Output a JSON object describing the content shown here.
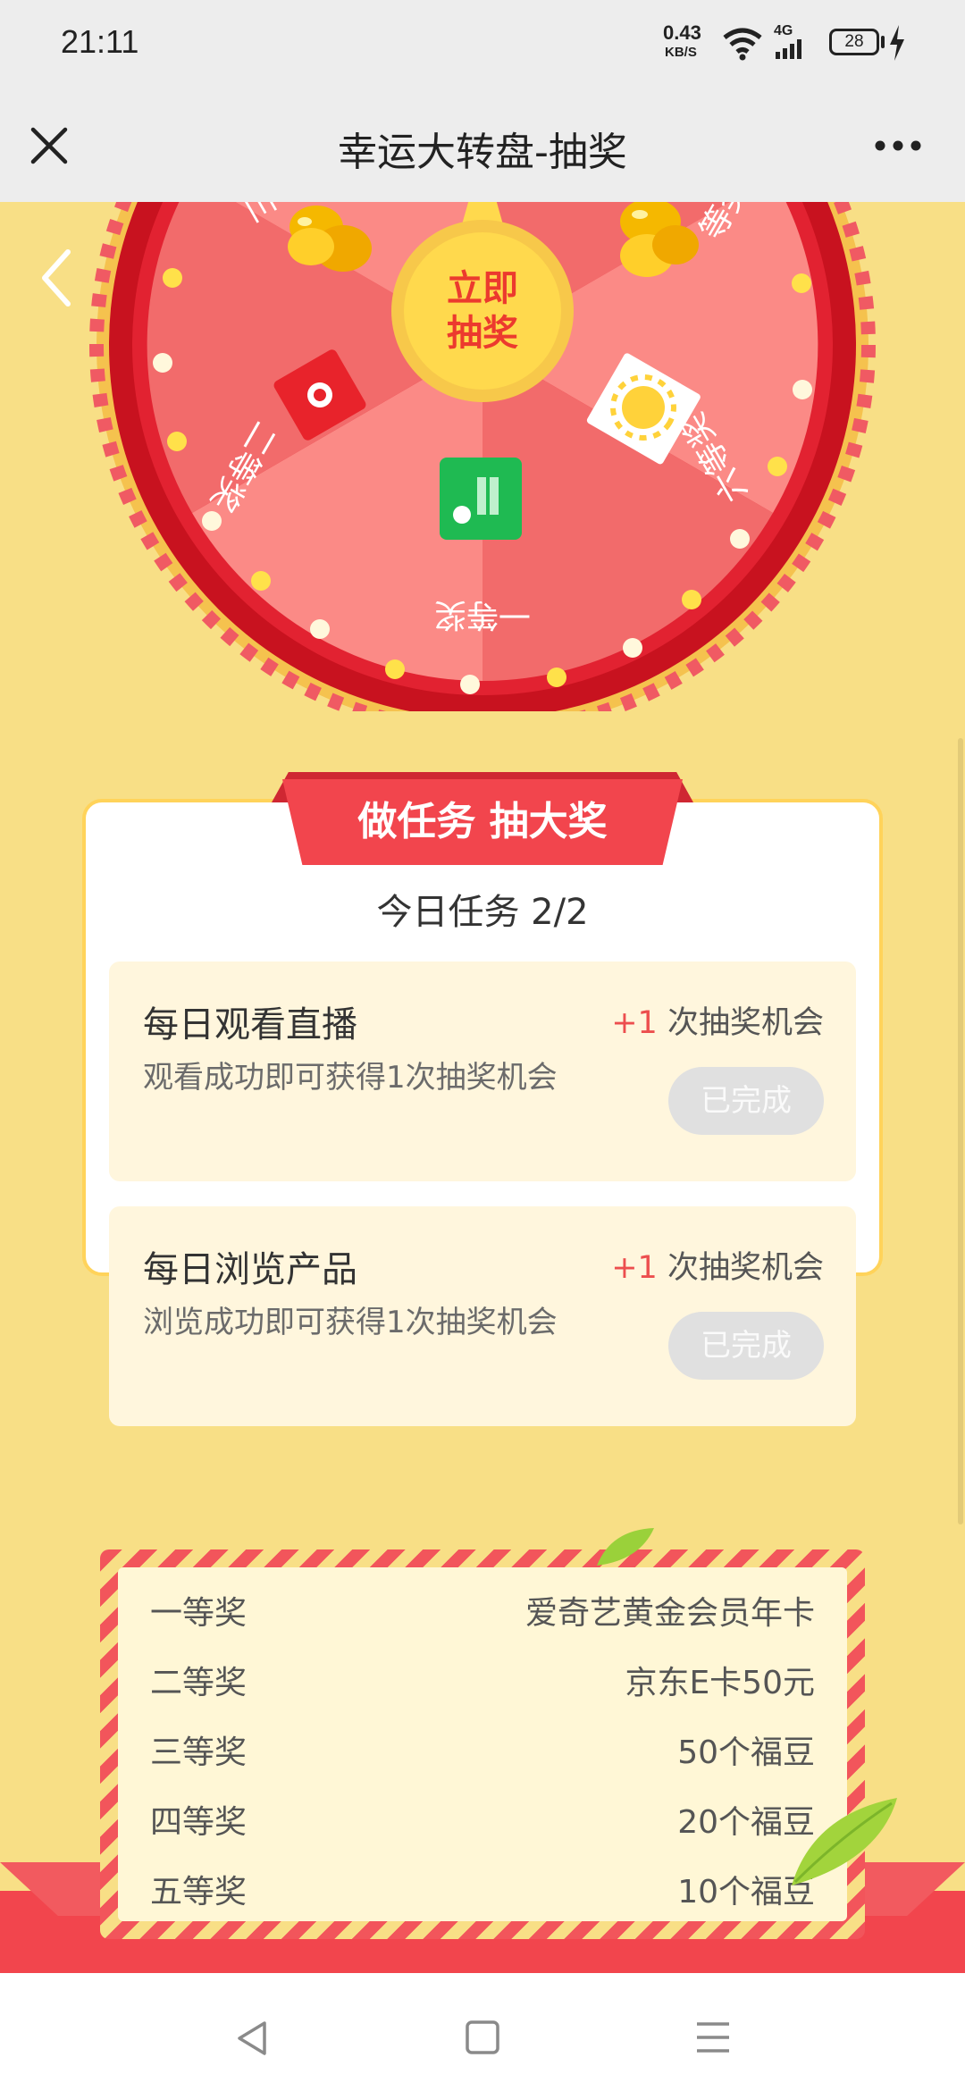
{
  "status": {
    "time": "21:11",
    "net_speed": "0.43",
    "net_unit": "KB/S",
    "signal": "4G",
    "battery": "28"
  },
  "nav": {
    "title": "幸运大转盘-抽奖"
  },
  "wheel": {
    "center_button": "立即抽奖",
    "center_button_line1": "立即",
    "center_button_line2": "抽奖",
    "segments": [
      "一等奖",
      "二等奖",
      "三",
      "等奖",
      "六等奖"
    ],
    "colors": {
      "rim": "#c8121f",
      "segment_light": "#fb8a86",
      "segment_dark": "#f26b6b",
      "center": "#ffd94d"
    }
  },
  "tasks": {
    "banner": "做任务 抽大奖",
    "summary": "今日任务 2/2",
    "items": [
      {
        "title": "每日观看直播",
        "desc": "观看成功即可获得1次抽奖机会",
        "reward_plus": "+1",
        "reward_text": "次抽奖机会",
        "button": "已完成"
      },
      {
        "title": "每日浏览产品",
        "desc": "浏览成功即可获得1次抽奖机会",
        "reward_plus": "+1",
        "reward_text": "次抽奖机会",
        "button": "已完成"
      }
    ]
  },
  "prizes": [
    {
      "level": "一等奖",
      "prize": "爱奇艺黄金会员年卡"
    },
    {
      "level": "二等奖",
      "prize": "京东E卡50元"
    },
    {
      "level": "三等奖",
      "prize": "50个福豆"
    },
    {
      "level": "四等奖",
      "prize": "20个福豆"
    },
    {
      "level": "五等奖",
      "prize": "10个福豆"
    }
  ],
  "colors": {
    "page_bg": "#f8df86",
    "accent_red": "#ec4e4e",
    "banner_red": "#f2454d",
    "task_card_bg": "#fff6dd"
  }
}
